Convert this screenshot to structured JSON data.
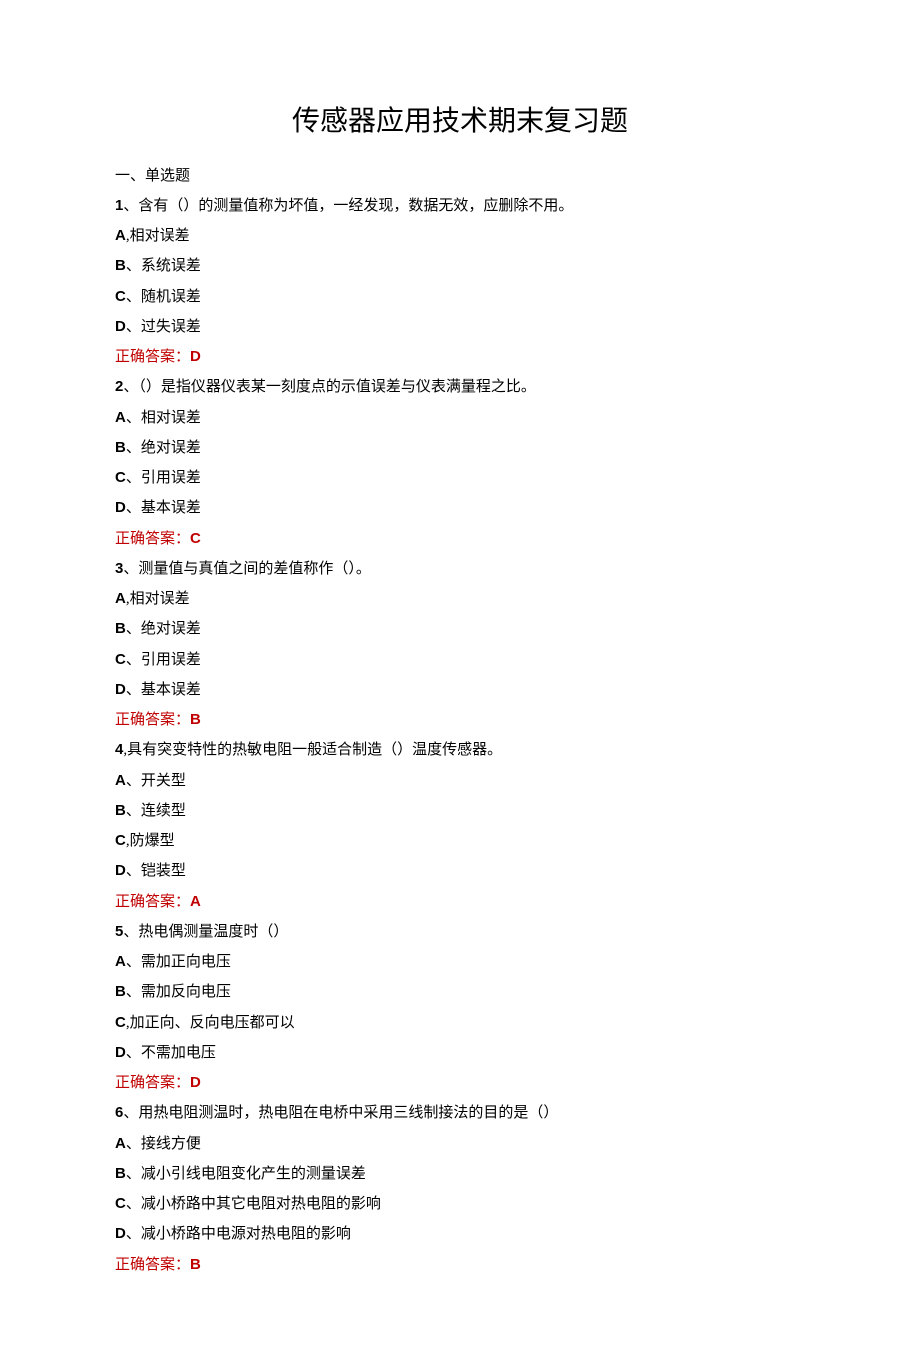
{
  "title": "传感器应用技术期末复习题",
  "section_heading": "一、单选题",
  "answer_prefix": "正确答案：",
  "questions": [
    {
      "num": "1",
      "punct": "、",
      "text": "含有（）的测量值称为坏值，一经发现，数据无效，应删除不用。",
      "options": [
        {
          "letter": "A",
          "sep": ",",
          "text": "相对误差"
        },
        {
          "letter": "B",
          "sep": "、",
          "text": "系统误差"
        },
        {
          "letter": "C",
          "sep": "、",
          "text": "随机误差"
        },
        {
          "letter": "D",
          "sep": "、",
          "text": "过失误差"
        }
      ],
      "answer": "D"
    },
    {
      "num": "2",
      "punct": "、",
      "text": "（）是指仪器仪表某一刻度点的示值误差与仪表满量程之比。",
      "options": [
        {
          "letter": "A",
          "sep": "、",
          "text": "相对误差"
        },
        {
          "letter": "B",
          "sep": "、",
          "text": "绝对误差"
        },
        {
          "letter": "C",
          "sep": "、",
          "text": "引用误差"
        },
        {
          "letter": "D",
          "sep": "、",
          "text": "基本误差"
        }
      ],
      "answer": "C"
    },
    {
      "num": "3",
      "punct": "、",
      "text": "测量值与真值之间的差值称作（）。",
      "options": [
        {
          "letter": "A",
          "sep": ",",
          "text": "相对误差"
        },
        {
          "letter": "B",
          "sep": "、",
          "text": "绝对误差"
        },
        {
          "letter": "C",
          "sep": "、",
          "text": "引用误差"
        },
        {
          "letter": "D",
          "sep": "、",
          "text": "基本误差"
        }
      ],
      "answer": "B"
    },
    {
      "num": "4",
      "punct": ",",
      "text": "具有突变特性的热敏电阻一般适合制造（）温度传感器。",
      "options": [
        {
          "letter": "A",
          "sep": "、",
          "text": "开关型"
        },
        {
          "letter": "B",
          "sep": "、",
          "text": "连续型"
        },
        {
          "letter": "C",
          "sep": ",",
          "text": "防爆型"
        },
        {
          "letter": "D",
          "sep": "、",
          "text": "铠装型"
        }
      ],
      "answer": "A"
    },
    {
      "num": "5",
      "punct": "、",
      "text": "热电偶测量温度时（）",
      "options": [
        {
          "letter": "A",
          "sep": "、",
          "text": "需加正向电压"
        },
        {
          "letter": "B",
          "sep": "、",
          "text": "需加反向电压"
        },
        {
          "letter": "C",
          "sep": ",",
          "text": "加正向、反向电压都可以"
        },
        {
          "letter": "D",
          "sep": "、",
          "text": "不需加电压"
        }
      ],
      "answer": "D"
    },
    {
      "num": "6",
      "punct": "、",
      "text": "用热电阻测温时，热电阻在电桥中采用三线制接法的目的是（）",
      "options": [
        {
          "letter": "A",
          "sep": "、",
          "text": "接线方便"
        },
        {
          "letter": "B",
          "sep": "、",
          "text": "减小引线电阻变化产生的测量误差"
        },
        {
          "letter": "C",
          "sep": "、",
          "text": "减小桥路中其它电阻对热电阻的影响"
        },
        {
          "letter": "D",
          "sep": "、",
          "text": "减小桥路中电源对热电阻的影响"
        }
      ],
      "answer": "B"
    }
  ]
}
